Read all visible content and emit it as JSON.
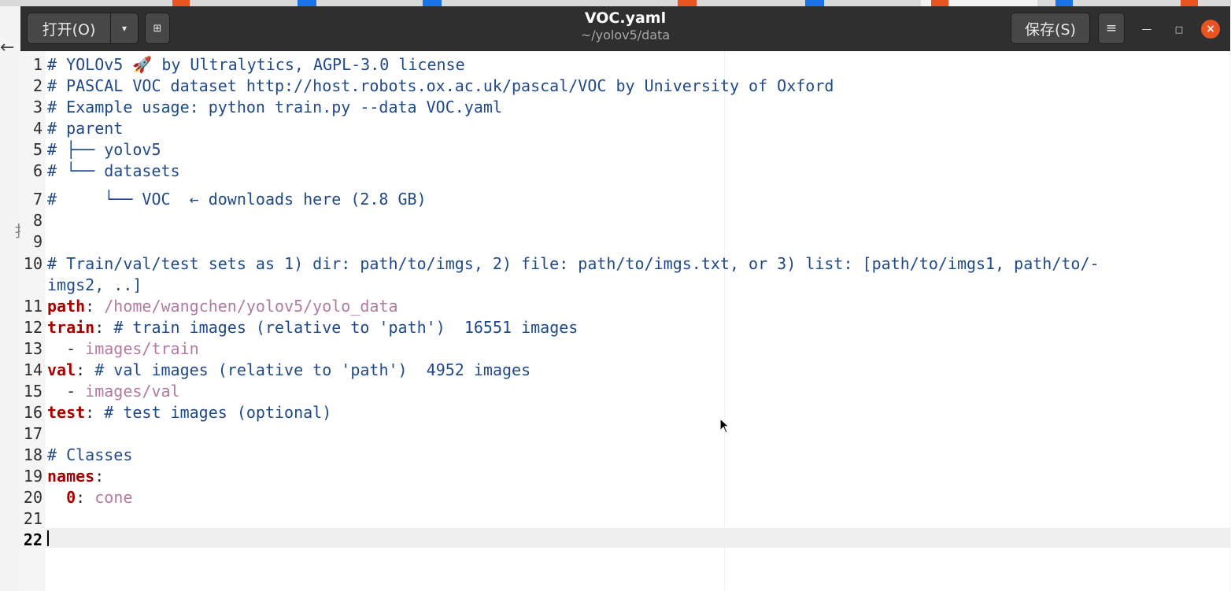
{
  "window": {
    "title": "VOC.yaml",
    "subtitle": "~/yolov5/data",
    "open_label": "打开(O)",
    "open_dropdown_glyph": "▾",
    "new_tab_glyph": "⊞",
    "save_label": "保存(S)",
    "menu_glyph": "≡",
    "minimize_glyph": "—",
    "maximize_glyph": "□",
    "close_glyph": "×"
  },
  "background": {
    "back_glyph": "←",
    "fragment": "扌"
  },
  "colors": {
    "headerbar": "#2f2f2f",
    "comment": "#204a87",
    "key": "#a40000",
    "string": "#b07aa1",
    "close_button": "#e95420"
  },
  "editor": {
    "current_line": 22,
    "lines": [
      {
        "n": "1",
        "segments": [
          {
            "t": "# YOLOv5 🚀 by Ultralytics, AGPL-3.0 license",
            "c": "cm"
          }
        ]
      },
      {
        "n": "2",
        "segments": [
          {
            "t": "# PASCAL VOC dataset http://host.robots.ox.ac.uk/pascal/VOC by University of Oxford",
            "c": "cm"
          }
        ]
      },
      {
        "n": "3",
        "segments": [
          {
            "t": "# Example usage: python train.py --data VOC.yaml",
            "c": "cm"
          }
        ]
      },
      {
        "n": "4",
        "segments": [
          {
            "t": "# parent",
            "c": "cm"
          }
        ]
      },
      {
        "n": "5",
        "segments": [
          {
            "t": "# ├── yolov5",
            "c": "cm"
          }
        ]
      },
      {
        "n": "6",
        "segments": [
          {
            "t": "# └── datasets",
            "c": "cm"
          }
        ]
      },
      {
        "n": "7",
        "segments": [
          {
            "t": "#     └── VOC  ← downloads here (2.8 GB)",
            "c": "cm"
          }
        ]
      },
      {
        "n": "8",
        "segments": []
      },
      {
        "n": "9",
        "segments": []
      },
      {
        "n": "10",
        "segments": [
          {
            "t": "# Train/val/test sets as 1) dir: path/to/imgs, 2) file: path/to/imgs.txt, or 3) list: [path/to/imgs1, path/to/-",
            "c": "cm"
          }
        ]
      },
      {
        "n": "",
        "segments": [
          {
            "t": "imgs2, ..]",
            "c": "cm"
          }
        ]
      },
      {
        "n": "11",
        "segments": [
          {
            "t": "path",
            "c": "key"
          },
          {
            "t": ": ",
            "c": ""
          },
          {
            "t": "/home/wangchen/yolov5/yolo_data",
            "c": "str"
          }
        ]
      },
      {
        "n": "12",
        "segments": [
          {
            "t": "train",
            "c": "key"
          },
          {
            "t": ": ",
            "c": ""
          },
          {
            "t": "# train images (relative to 'path')  16551 images",
            "c": "cm"
          }
        ]
      },
      {
        "n": "13",
        "segments": [
          {
            "t": "  - ",
            "c": ""
          },
          {
            "t": "images/train",
            "c": "str"
          }
        ]
      },
      {
        "n": "14",
        "segments": [
          {
            "t": "val",
            "c": "key"
          },
          {
            "t": ": ",
            "c": ""
          },
          {
            "t": "# val images (relative to 'path')  4952 images",
            "c": "cm"
          }
        ]
      },
      {
        "n": "15",
        "segments": [
          {
            "t": "  - ",
            "c": ""
          },
          {
            "t": "images/val",
            "c": "str"
          }
        ]
      },
      {
        "n": "16",
        "segments": [
          {
            "t": "test",
            "c": "key"
          },
          {
            "t": ": ",
            "c": ""
          },
          {
            "t": "# test images (optional)",
            "c": "cm"
          }
        ]
      },
      {
        "n": "17",
        "segments": []
      },
      {
        "n": "18",
        "segments": [
          {
            "t": "# Classes",
            "c": "cm"
          }
        ]
      },
      {
        "n": "19",
        "segments": [
          {
            "t": "names",
            "c": "key"
          },
          {
            "t": ":",
            "c": ""
          }
        ]
      },
      {
        "n": "20",
        "segments": [
          {
            "t": "  ",
            "c": ""
          },
          {
            "t": "0",
            "c": "key"
          },
          {
            "t": ": ",
            "c": ""
          },
          {
            "t": "cone",
            "c": "str"
          }
        ]
      },
      {
        "n": "21",
        "segments": []
      },
      {
        "n": "22",
        "segments": []
      }
    ]
  }
}
